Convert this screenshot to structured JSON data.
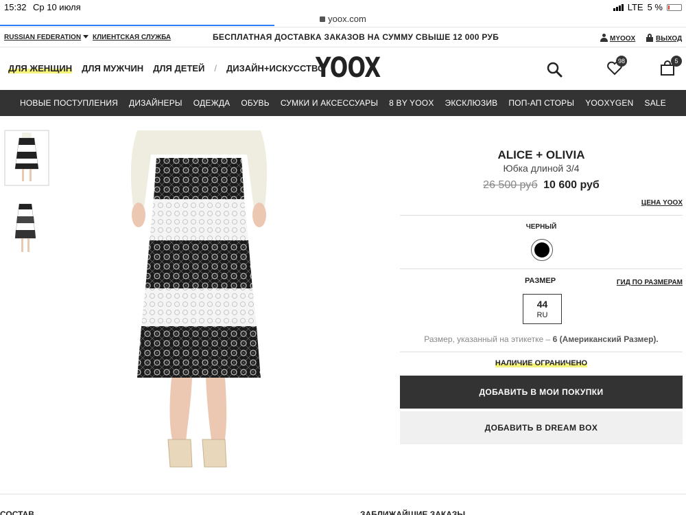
{
  "statusbar": {
    "time": "15:32",
    "date": "Ср 10 июля",
    "network": "LTE",
    "battery": "5 %"
  },
  "browser": {
    "url": "yoox.com"
  },
  "utility": {
    "region": "RUSSIAN FEDERATION",
    "service": "КЛИЕНТСКАЯ СЛУЖБА",
    "promo": "БЕСПЛАТНАЯ ДОСТАВКА ЗАКАЗОВ НА СУММУ СВЫШЕ 12 000 РУБ",
    "account": "MYOOX",
    "logout": "ВЫХОД"
  },
  "header": {
    "categories": [
      "ДЛЯ ЖЕНЩИН",
      "ДЛЯ МУЖЧИН",
      "ДЛЯ ДЕТЕЙ"
    ],
    "separator": "/",
    "design": "ДИЗАЙН+ИСКУССТВО",
    "logo": "YOOX",
    "wishlist_count": "98",
    "cart_count": "5"
  },
  "nav": [
    "НОВЫЕ ПОСТУПЛЕНИЯ",
    "ДИЗАЙНЕРЫ",
    "ОДЕЖДА",
    "ОБУВЬ",
    "СУМКИ И АКСЕССУАРЫ",
    "8 BY YOOX",
    "ЭКСКЛЮЗИВ",
    "ПОП-АП СТОРЫ",
    "YOOXYGEN",
    "SALE"
  ],
  "product": {
    "brand": "ALICE + OLIVIA",
    "type": "Юбка длиной 3/4",
    "old_price": "26 500 руб",
    "price": "10 600 руб",
    "price_link": "ЦЕНА YOOX",
    "color": "ЧЕРНЫЙ",
    "size_label": "РАЗМЕР",
    "size_guide": "ГИД ПО РАЗМЕРАМ",
    "size_value": "44",
    "size_region": "RU",
    "size_note_prefix": "Размер, указанный на этикетке –",
    "size_note_value": "6 (Американский Размер).",
    "availability": "НАЛИЧИЕ ОГРАНИЧЕНО",
    "buy_button": "ДОБАВИТЬ В МОИ ПОКУПКИ",
    "dream_button": "ДОБАВИТЬ В DREAM BOX"
  },
  "bottom": {
    "left": "СОСТАВ",
    "right": "ЗАБЛИЖАЙШИЕ ЗАКАЗЫ"
  },
  "colors": {
    "dark": "#333333",
    "highlight": "#f5f37a",
    "accent": "#2d7ff9"
  }
}
